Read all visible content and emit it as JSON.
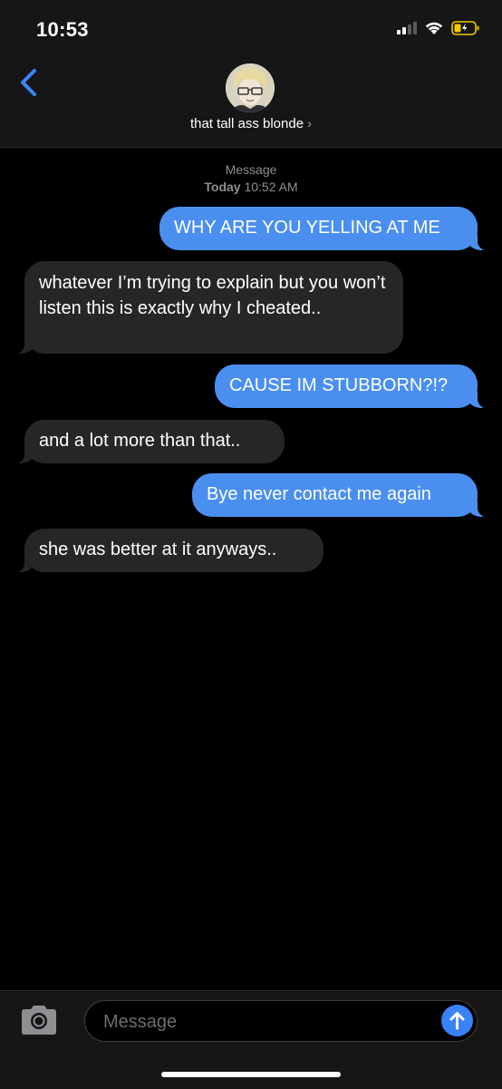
{
  "status_bar": {
    "time": "10:53"
  },
  "header": {
    "contact_name": "that tall ass blonde",
    "name_chevron": "›"
  },
  "thread": {
    "service_label": "Message",
    "day_label": "Today",
    "time_label": "10:52 AM",
    "messages": [
      {
        "direction": "outgoing",
        "text": "WHY ARE YOU YELLING AT ME"
      },
      {
        "direction": "incoming",
        "text": "whatever I’m trying to explain but you won’t listen this is exactly why I cheated.."
      },
      {
        "direction": "outgoing",
        "text": "CAUSE IM STUBBORN?!?"
      },
      {
        "direction": "incoming",
        "text": "and a lot more than that.."
      },
      {
        "direction": "outgoing",
        "text": "Bye never contact me again"
      },
      {
        "direction": "incoming",
        "text": "she was better at it anyways.."
      }
    ]
  },
  "composer": {
    "placeholder": "Message"
  },
  "icons": {
    "back": "chevron-left-icon",
    "camera": "camera-icon",
    "send": "arrow-up-icon",
    "wifi": "wifi-icon",
    "battery": "battery-charging-icon",
    "signal": "cellular-signal-icon"
  },
  "colors": {
    "outgoing_bubble": "#4a8ff0",
    "incoming_bubble": "#262628",
    "accent": "#3a82f7",
    "battery_charging": "#f2c900"
  }
}
